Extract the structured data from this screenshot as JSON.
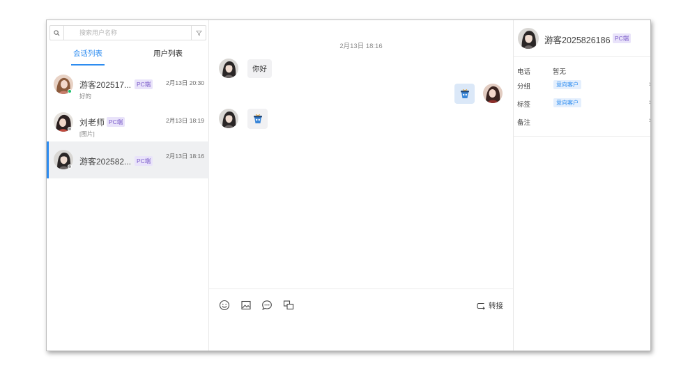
{
  "search": {
    "placeholder": "搜索用户名称"
  },
  "tabs": [
    {
      "label": "会话列表"
    },
    {
      "label": "用户列表"
    }
  ],
  "conversations": [
    {
      "name": "游客202517...",
      "badge": "PC端",
      "time": "2月13日 20:30",
      "preview": "好的",
      "status_color": "#19be6b"
    },
    {
      "name": "刘老师",
      "badge": "PC端",
      "time": "2月13日 18:19",
      "preview": "[图片]",
      "status_color": "#9e9e9e"
    },
    {
      "name": "游客202582...",
      "badge": "PC端",
      "time": "2月13日 18:16",
      "preview": "",
      "status_color": "#9e9e9e"
    }
  ],
  "chat": {
    "timestamp": "2月13日 18:16",
    "messages": [
      {
        "side": "left",
        "type": "text",
        "text": "你好"
      },
      {
        "side": "right",
        "type": "image",
        "icon": "sticker-icon"
      },
      {
        "side": "left",
        "type": "image",
        "icon": "sticker-icon"
      }
    ],
    "toolbar": {
      "icons": [
        "emoji-icon",
        "image-icon",
        "quick-reply-icon",
        "history-icon"
      ],
      "transfer_label": "转接"
    }
  },
  "profile": {
    "name": "游客2025826186",
    "badge": "PC端",
    "fields": [
      {
        "label": "电话",
        "value": "暂无"
      },
      {
        "label": "分组",
        "tag": "意向客户"
      },
      {
        "label": "标签",
        "tag": "意向客户"
      },
      {
        "label": "备注",
        "value": ""
      }
    ]
  },
  "colors": {
    "accent": "#2d8cf0",
    "badge_text": "#7b5cc9",
    "badge_bg": "#e9e3fa",
    "online": "#19be6b"
  }
}
